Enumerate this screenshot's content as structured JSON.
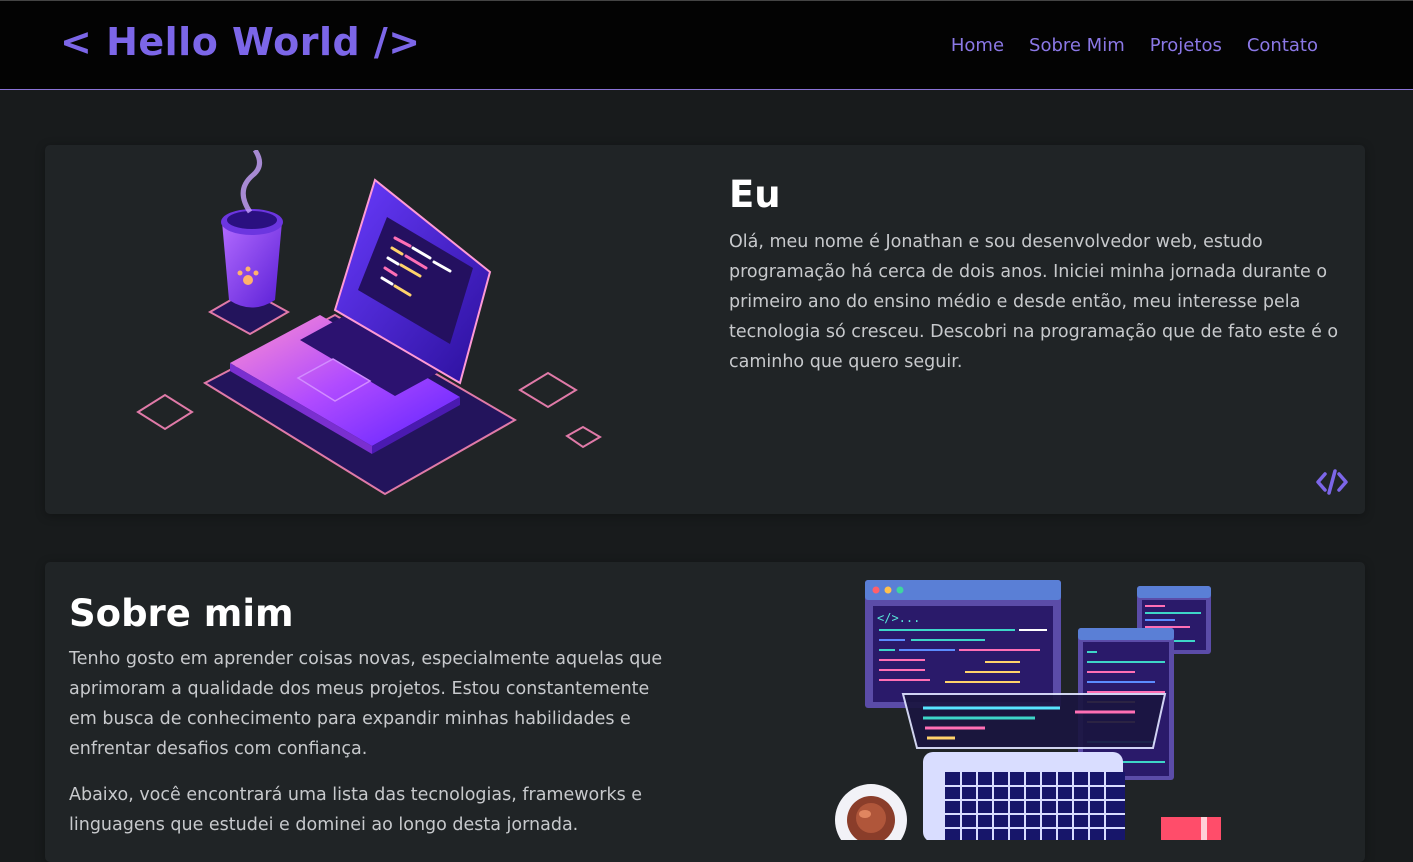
{
  "header": {
    "logo": "< Hello World />",
    "nav": [
      "Home",
      "Sobre Mim",
      "Projetos",
      "Contato"
    ]
  },
  "eu": {
    "title": "Eu",
    "text": "Olá, meu nome é Jonathan e sou desenvolvedor web, estudo programação há cerca de dois anos. Iniciei minha jornada durante o primeiro ano do ensino médio e desde então, meu interesse pela tecnologia só cresceu. Descobri na programação que de fato este é o caminho que quero seguir.",
    "icon": "code-icon"
  },
  "sobre": {
    "title": "Sobre mim",
    "text1": "Tenho gosto em aprender coisas novas, especialmente aquelas que aprimoram a qualidade dos meus projetos. Estou constantemente em busca de conhecimento para expandir minhas habilidades e enfrentar desafios com confiança.",
    "text2": "Abaixo, você encontrará uma lista das tecnologias, frameworks e linguagens que estudei e dominei ao longo desta jornada.",
    "code_label": "</>..."
  },
  "colors": {
    "accent": "#7c66e8",
    "nav": "#8b78e6",
    "background": "#181b1c",
    "card": "#202426"
  }
}
